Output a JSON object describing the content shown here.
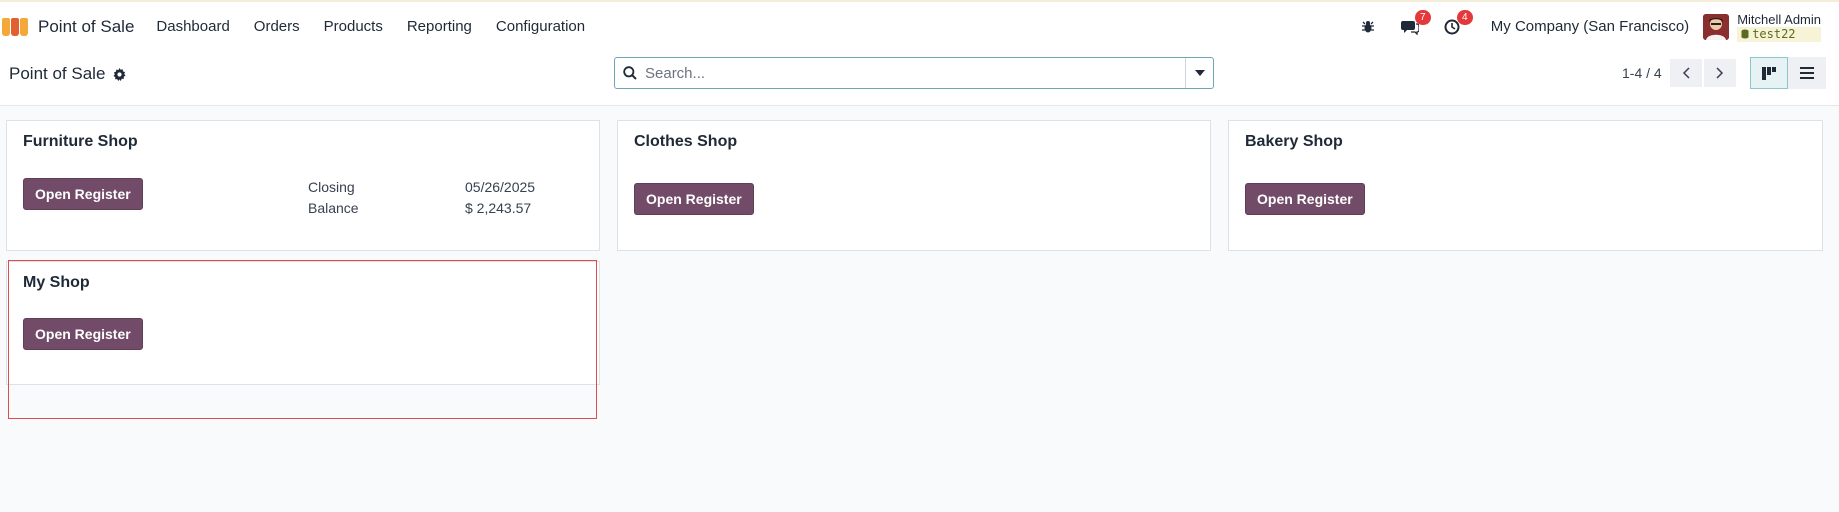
{
  "topbar": {
    "app_title": "Point of Sale",
    "nav": [
      "Dashboard",
      "Orders",
      "Products",
      "Reporting",
      "Configuration"
    ],
    "messages_count": "7",
    "activities_count": "4",
    "company": "My Company (San Francisco)",
    "user_name": "Mitchell Admin",
    "database": "test22"
  },
  "control": {
    "page_title": "Point of Sale",
    "search_placeholder": "Search...",
    "pager": "1-4 / 4"
  },
  "cards": [
    {
      "name": "Furniture Shop",
      "button": "Open Register",
      "closing_label": "Closing",
      "closing_value": "05/26/2025",
      "balance_label": "Balance",
      "balance_value": "$ 2,243.57"
    },
    {
      "name": "Clothes Shop",
      "button": "Open Register"
    },
    {
      "name": "Bakery Shop",
      "button": "Open Register"
    },
    {
      "name": "My Shop",
      "button": "Open Register"
    }
  ],
  "colors": {
    "accent": "#714b67",
    "highlight": "#e04b4b",
    "badge": "#e5383b"
  },
  "icons": [
    "app-logo-icon",
    "bug-icon",
    "chat-icon",
    "clock-icon",
    "gear-icon",
    "search-icon",
    "caret-down-icon",
    "chevron-left-icon",
    "chevron-right-icon",
    "kanban-view-icon",
    "list-view-icon",
    "database-icon"
  ]
}
